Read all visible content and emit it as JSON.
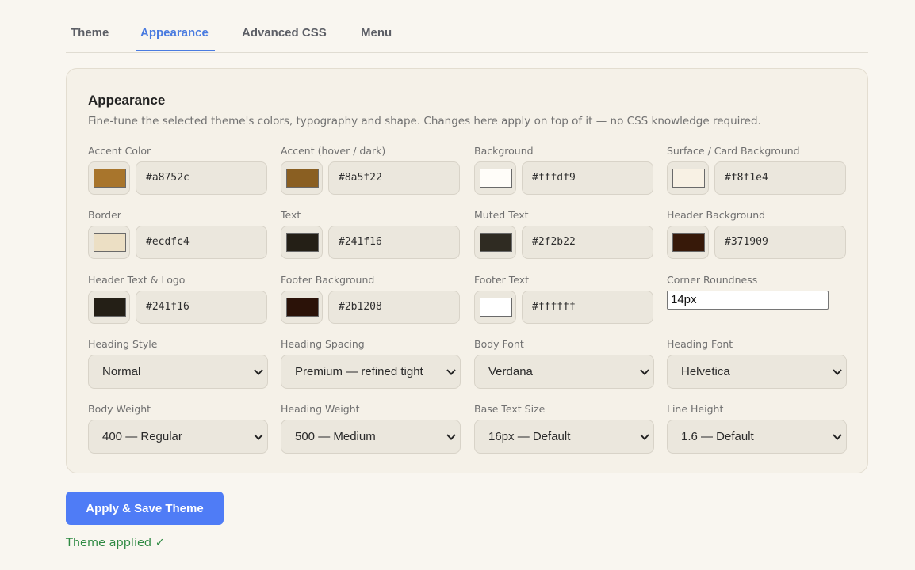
{
  "tabs": [
    {
      "label": "Theme",
      "active": false
    },
    {
      "label": "Appearance",
      "active": true
    },
    {
      "label": "Advanced CSS",
      "active": false
    },
    {
      "label": "Menu",
      "active": false
    }
  ],
  "panel": {
    "title": "Appearance",
    "description": "Fine-tune the selected theme's colors, typography and shape. Changes here apply on top of it — no CSS knowledge required."
  },
  "colors": [
    {
      "label": "Accent Color",
      "value": "#a8752c"
    },
    {
      "label": "Accent (hover / dark)",
      "value": "#8a5f22"
    },
    {
      "label": "Background",
      "value": "#fffdf9"
    },
    {
      "label": "Surface / Card Background",
      "value": "#f8f1e4"
    },
    {
      "label": "Border",
      "value": "#ecdfc4"
    },
    {
      "label": "Text",
      "value": "#241f16"
    },
    {
      "label": "Muted Text",
      "value": "#2f2b22"
    },
    {
      "label": "Header Background",
      "value": "#371909"
    },
    {
      "label": "Header Text & Logo",
      "value": "#241f16"
    },
    {
      "label": "Footer Background",
      "value": "#2b1208"
    },
    {
      "label": "Footer Text",
      "value": "#ffffff"
    }
  ],
  "corner": {
    "label": "Corner Roundness",
    "value": "14px"
  },
  "selects": [
    {
      "label": "Heading Style",
      "value": "Normal"
    },
    {
      "label": "Heading Spacing",
      "value": "Premium — refined tight"
    },
    {
      "label": "Body Font",
      "value": "Verdana"
    },
    {
      "label": "Heading Font",
      "value": "Helvetica"
    },
    {
      "label": "Body Weight",
      "value": "400 — Regular"
    },
    {
      "label": "Heading Weight",
      "value": "500 — Medium"
    },
    {
      "label": "Base Text Size",
      "value": "16px — Default"
    },
    {
      "label": "Line Height",
      "value": "1.6 — Default"
    }
  ],
  "save_button": {
    "label": "Apply & Save Theme"
  },
  "status": {
    "text": "Theme applied ✓"
  }
}
